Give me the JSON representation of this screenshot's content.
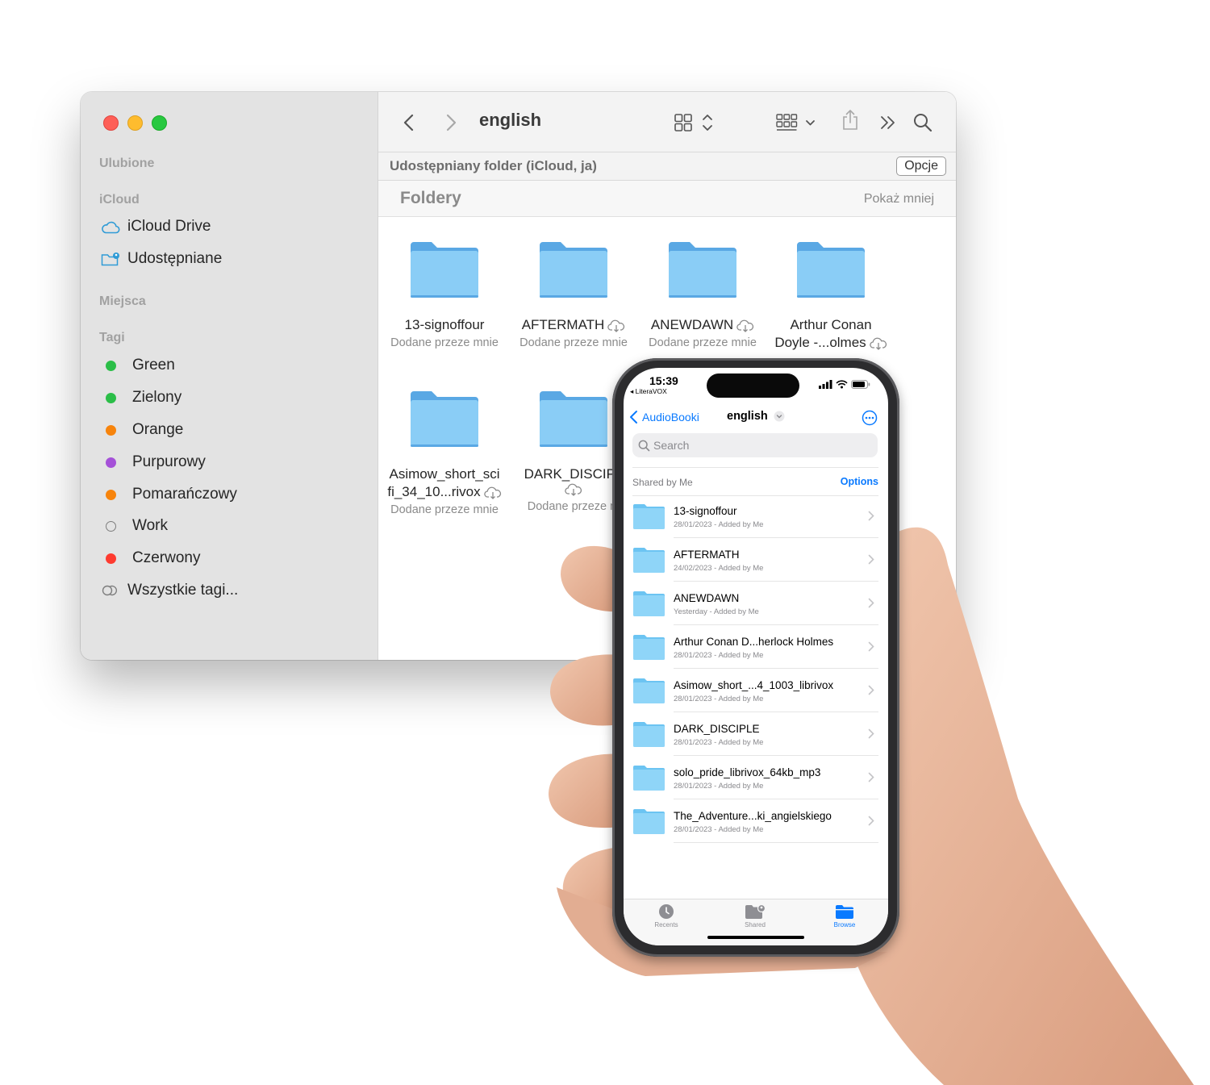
{
  "finder": {
    "title": "english",
    "sidebar": {
      "section_favorites": "Ulubione",
      "section_icloud": "iCloud",
      "icloud_items": [
        {
          "label": "iCloud Drive",
          "icon": "cloud-icon"
        },
        {
          "label": "Udostępniane",
          "icon": "shared-folder-icon"
        }
      ],
      "section_places": "Miejsca",
      "section_tags": "Tagi",
      "tags": [
        {
          "label": "Green",
          "color": "#2bbe48"
        },
        {
          "label": "Zielony",
          "color": "#2bbe48"
        },
        {
          "label": "Orange",
          "color": "#f7840c"
        },
        {
          "label": "Purpurowy",
          "color": "#a551d8"
        },
        {
          "label": "Pomarańczowy",
          "color": "#f7840c"
        },
        {
          "label": "Work",
          "color": "none"
        },
        {
          "label": "Czerwony",
          "color": "#fe3b30"
        }
      ],
      "all_tags": "Wszystkie tagi..."
    },
    "shared_bar": {
      "label": "Udostępniany folder (iCloud, ja)",
      "options": "Opcje"
    },
    "group": {
      "label": "Foldery",
      "toggle": "Pokaż mniej"
    },
    "folders": [
      {
        "name": "13-signoffour",
        "sub": "Dodane przeze mnie"
      },
      {
        "name": "AFTERMATH",
        "sub": "Dodane przeze mnie"
      },
      {
        "name": "ANEWDAWN",
        "sub": "Dodane przeze mnie"
      },
      {
        "name1": "Arthur Conan",
        "name2": "Doyle -...olmes"
      },
      {
        "name1": "Asimow_short_sci",
        "name2": "fi_34_10...rivox",
        "sub": "Dodane przeze mnie"
      },
      {
        "name": "DARK_DISCIPL",
        "sub": "Dodane przeze m"
      }
    ]
  },
  "phone": {
    "status": {
      "time": "15:39",
      "back_app": "◂ LiteraVOX"
    },
    "nav": {
      "back": "AudioBooki",
      "title": "english"
    },
    "search_placeholder": "Search",
    "shared_label": "Shared by Me",
    "options": "Options",
    "rows": [
      {
        "name": "13-signoffour",
        "sub": "28/01/2023 - Added by Me"
      },
      {
        "name": "AFTERMATH",
        "sub": "24/02/2023 - Added by Me"
      },
      {
        "name": "ANEWDAWN",
        "sub": "Yesterday - Added by Me"
      },
      {
        "name": "Arthur Conan D...herlock Holmes",
        "sub": "28/01/2023 - Added by Me"
      },
      {
        "name": "Asimow_short_...4_1003_librivox",
        "sub": "28/01/2023 - Added by Me"
      },
      {
        "name": "DARK_DISCIPLE",
        "sub": "28/01/2023 - Added by Me"
      },
      {
        "name": "solo_pride_librivox_64kb_mp3",
        "sub": "28/01/2023 - Added by Me"
      },
      {
        "name": "The_Adventure...ki_angielskiego",
        "sub": "28/01/2023 - Added by Me"
      }
    ],
    "tabs": [
      {
        "label": "Recents",
        "icon": "clock-icon"
      },
      {
        "label": "Shared",
        "icon": "shared-folder-icon"
      },
      {
        "label": "Browse",
        "icon": "folder-icon"
      }
    ],
    "accent": "#0a7aff"
  }
}
